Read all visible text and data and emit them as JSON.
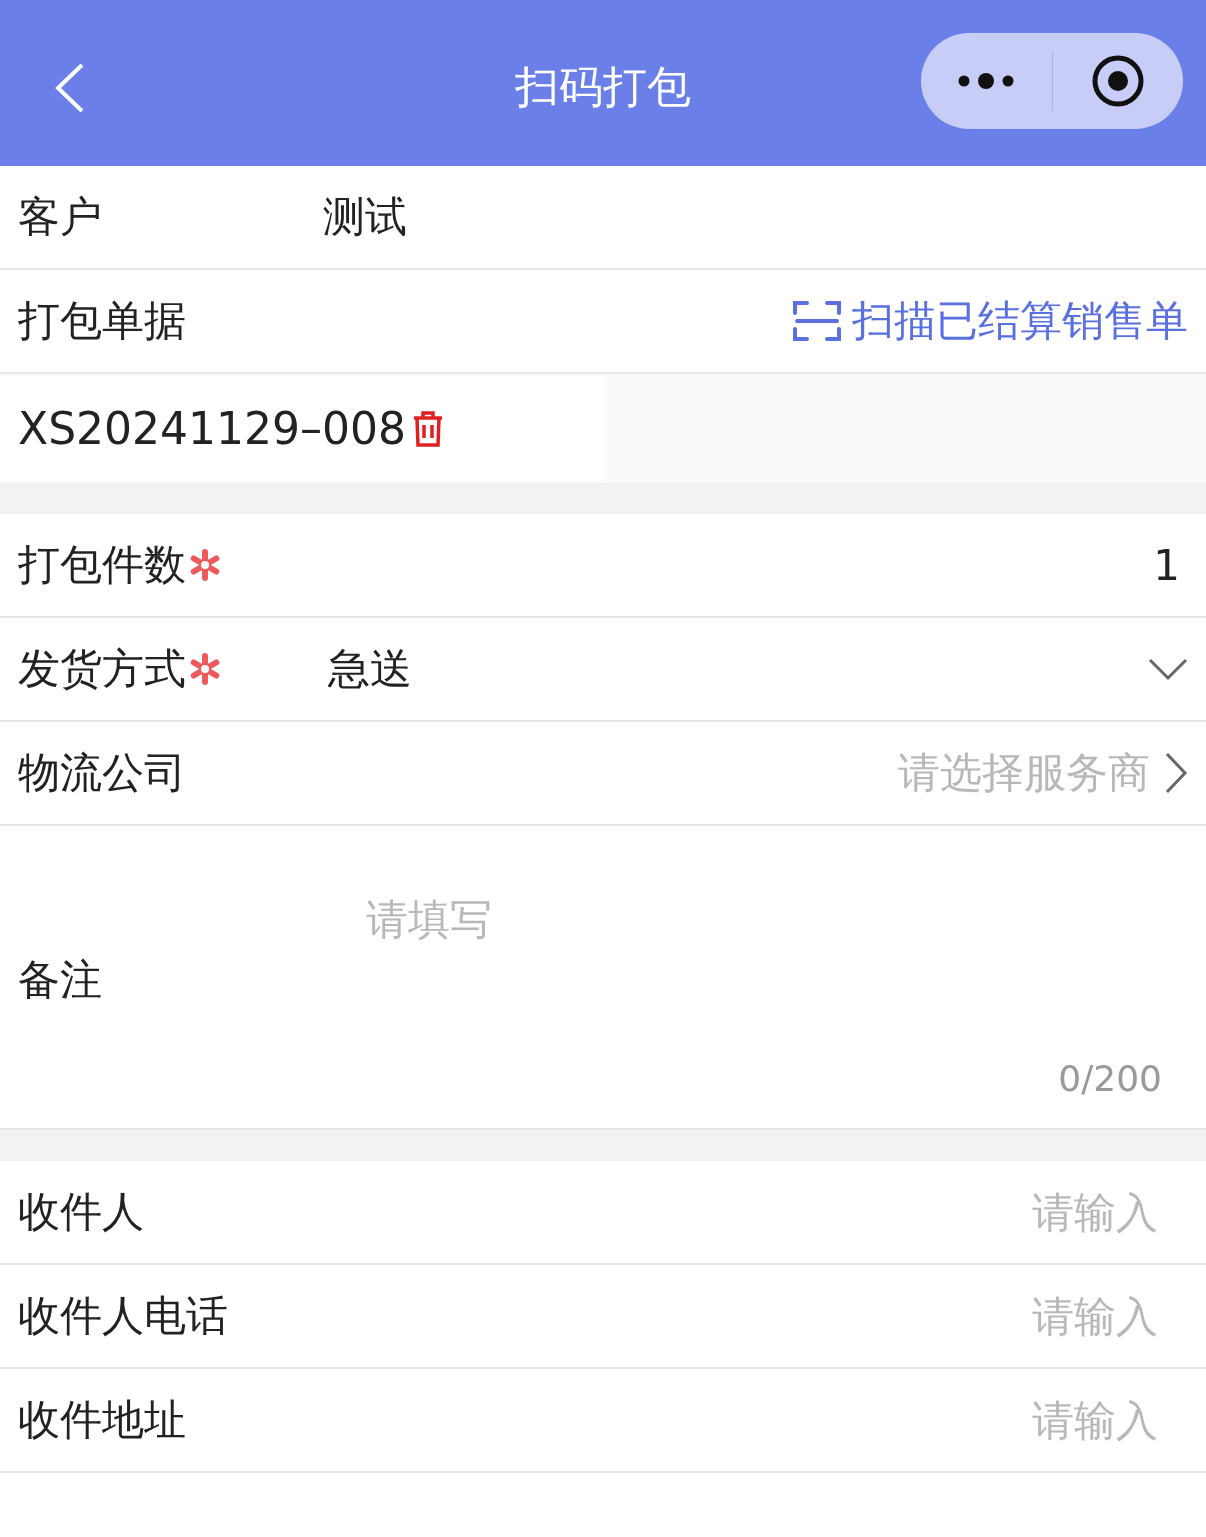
{
  "header": {
    "title": "扫码打包"
  },
  "sections": [
    {
      "rows": [
        {
          "kind": "value",
          "label": "客户",
          "value": "测试",
          "required": false
        },
        {
          "kind": "action",
          "label": "打包单据",
          "action": "扫描已结算销售单",
          "required": false
        },
        {
          "kind": "document",
          "value": "XS20241129–008"
        }
      ]
    },
    {
      "rows": [
        {
          "kind": "number",
          "label": "打包件数",
          "value": "1",
          "required": true
        },
        {
          "kind": "select",
          "label": "发货方式",
          "value": "急送",
          "required": true
        },
        {
          "kind": "picker",
          "label": "物流公司",
          "placeholder": "请选择服务商",
          "required": false
        },
        {
          "kind": "textarea",
          "label": "备注",
          "placeholder": "请填写",
          "counter": "0/200",
          "required": false
        }
      ]
    },
    {
      "rows": [
        {
          "kind": "input",
          "label": "收件人",
          "placeholder": "请输入",
          "required": false
        },
        {
          "kind": "input",
          "label": "收件人电话",
          "placeholder": "请输入",
          "required": false
        },
        {
          "kind": "input",
          "label": "收件地址",
          "placeholder": "请输入",
          "required": false
        }
      ]
    }
  ]
}
